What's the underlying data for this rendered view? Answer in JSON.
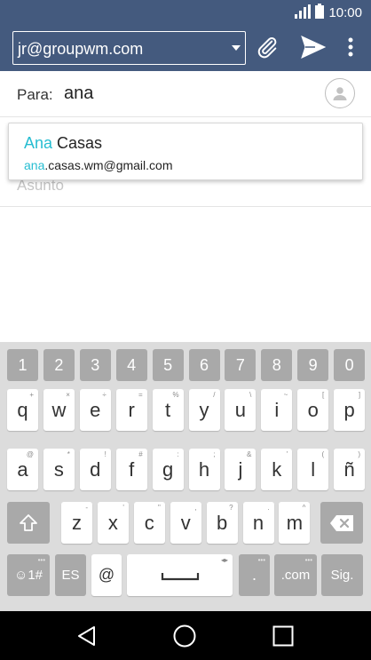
{
  "status": {
    "time": "10:00"
  },
  "app_bar": {
    "account": "jr@groupwm.com"
  },
  "compose": {
    "to_label": "Para:",
    "to_value": "ana",
    "subject_placeholder": "Asunto"
  },
  "suggestion": {
    "name_highlight": "Ana",
    "name_rest": " Casas",
    "email_highlight": "ana",
    "email_rest": ".casas.wm@gmail.com",
    "highlight_color": "#26bdd1"
  },
  "keyboard": {
    "numbers": [
      "1",
      "2",
      "3",
      "4",
      "5",
      "6",
      "7",
      "8",
      "9",
      "0"
    ],
    "row1": [
      {
        "label": "q",
        "hint": "+"
      },
      {
        "label": "w",
        "hint": "×"
      },
      {
        "label": "e",
        "hint": "÷"
      },
      {
        "label": "r",
        "hint": "="
      },
      {
        "label": "t",
        "hint": "%"
      },
      {
        "label": "y",
        "hint": "/"
      },
      {
        "label": "u",
        "hint": "\\"
      },
      {
        "label": "i",
        "hint": "~"
      },
      {
        "label": "o",
        "hint": "["
      },
      {
        "label": "p",
        "hint": "]"
      }
    ],
    "row2": [
      {
        "label": "a",
        "hint": "@"
      },
      {
        "label": "s",
        "hint": "*"
      },
      {
        "label": "d",
        "hint": "!"
      },
      {
        "label": "f",
        "hint": "#"
      },
      {
        "label": "g",
        "hint": ":"
      },
      {
        "label": "h",
        "hint": ";"
      },
      {
        "label": "j",
        "hint": "&"
      },
      {
        "label": "k",
        "hint": "'"
      },
      {
        "label": "l",
        "hint": "("
      },
      {
        "label": "ñ",
        "hint": ")"
      }
    ],
    "row3": [
      {
        "label": "z",
        "hint": "-"
      },
      {
        "label": "x",
        "hint": "'"
      },
      {
        "label": "c",
        "hint": "\""
      },
      {
        "label": "v",
        "hint": ","
      },
      {
        "label": "b",
        "hint": "?"
      },
      {
        "label": "n",
        "hint": "."
      },
      {
        "label": "m",
        "hint": "^"
      }
    ],
    "symbols_key": "☺1#",
    "lang_key": "ES",
    "at_key": "@",
    "period_key": ".",
    "com_key": ".com",
    "next_key": "Sig.",
    "space_hint": "◂▸"
  },
  "colors": {
    "app_bar": "#445a7e",
    "keyboard_bg": "#dcdcdc",
    "func_key": "#a9a9a9"
  },
  "icons": [
    "signal-icon",
    "battery-icon",
    "attach-icon",
    "send-icon",
    "more-icon",
    "contact-icon",
    "shift-icon",
    "backspace-icon",
    "back-icon",
    "home-icon",
    "recents-icon"
  ]
}
